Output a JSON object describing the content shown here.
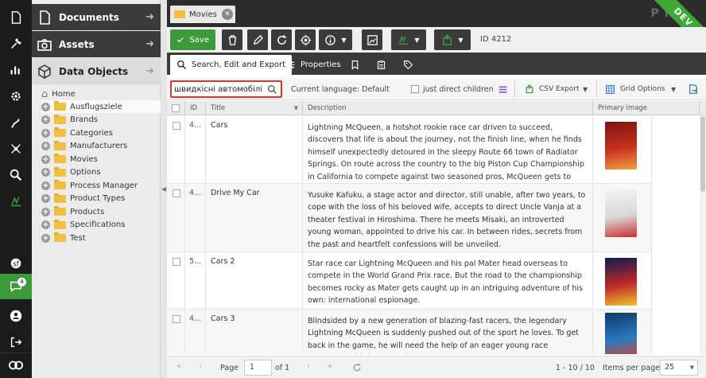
{
  "sidebar_icons": [
    "file-icon",
    "wrench-icon",
    "bar-chart-icon",
    "gear-icon",
    "marketing-icon",
    "network-icon",
    "search-icon",
    "datahub-icon",
    "symfony-icon",
    "chat-icon",
    "user-icon",
    "logout-icon",
    "pimcore-logo-icon"
  ],
  "chat_badge": "4",
  "panels": {
    "documents": "Documents",
    "assets": "Assets",
    "data_objects": "Data Objects"
  },
  "tree": {
    "root": "Home",
    "folders": [
      "Ausflugsziele",
      "Brands",
      "Categories",
      "Manufacturers",
      "Movies",
      "Options",
      "Process Manager",
      "Product Types",
      "Products",
      "Specifications",
      "Test"
    ]
  },
  "tab": {
    "title": "Movies"
  },
  "env_ribbon": "DEV",
  "toolbar": {
    "save": "Save",
    "id_label": "ID 4212"
  },
  "subtabs": {
    "search_edit_export": "Search, Edit and Export",
    "properties": "Properties"
  },
  "search": {
    "value": "швидкісні автомобілі",
    "current_language": "Current language: Default",
    "direct_children": "just direct children",
    "csv_export": "CSV Export",
    "grid_options": "Grid Options"
  },
  "grid": {
    "headers": {
      "id": "ID",
      "title": "Title",
      "description": "Description",
      "primary_image": "Primary image"
    },
    "rows": [
      {
        "id": "4...",
        "title": "Cars",
        "description": "Lightning McQueen, a hotshot rookie race car driven to succeed, discovers that life is about the journey, not the finish line, when he finds himself unexpectedly detoured in the sleepy Route 66 town of Radiator Springs. On route across the country to the big Piston Cup Championship in California to compete against two seasoned pros, McQueen gets to know the town's offbeat characters."
      },
      {
        "id": "4...",
        "title": "Drive My Car",
        "description": "Yusuke Kafuku, a stage actor and director, still unable, after two years, to cope with the loss of his beloved wife, accepts to direct Uncle Vanja at a theater festival in Hiroshima. There he meets Misaki, an introverted young woman, appointed to drive his car. In between rides, secrets from the past and heartfelt confessions will be unveiled."
      },
      {
        "id": "5...",
        "title": "Cars 2",
        "description": "Star race car Lightning McQueen and his pal Mater head overseas to compete in the World Grand Prix race. But the road to the championship becomes rocky as Mater gets caught up in an intriguing adventure of his own: international espionage."
      },
      {
        "id": "4...",
        "title": "Cars 3",
        "description": "Blindsided by a new generation of blazing-fast racers, the legendary Lightning McQueen is suddenly pushed out of the sport he loves. To get back in the game, he will need the help of an eager young race technician with her own plan to"
      }
    ]
  },
  "paging": {
    "page_label": "Page",
    "page": "1",
    "of": "of 1",
    "range": "1 - 10 / 10",
    "per_page_label": "Items per page",
    "per_page": "25"
  }
}
